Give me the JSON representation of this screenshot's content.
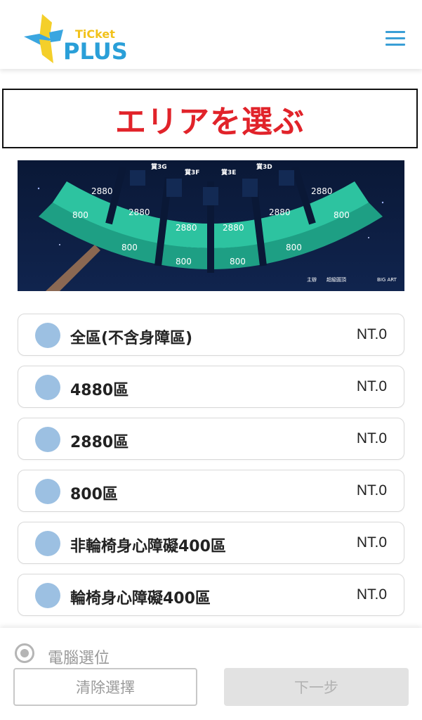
{
  "header": {
    "logo_small": "TiCket",
    "logo_big": "PLUS",
    "menu_icon": "hamburger-menu-icon"
  },
  "banner": {
    "title": "エリアを選ぶ"
  },
  "seatmap": {
    "gate_labels": [
      "賞3G",
      "賞3F",
      "賞3E",
      "賞3D"
    ],
    "inner_prices": [
      "2880",
      "2880",
      "2880",
      "2880",
      "2880",
      "2880"
    ],
    "outer_prices": [
      "800",
      "800",
      "800",
      "800",
      "800",
      "800"
    ],
    "sponsor_label": "主辦",
    "sponsor_1": "超級圓頂",
    "sponsor_2": "BIG ART",
    "colors": {
      "seat": "#2dbf9a",
      "seat_dark": "#1f9f82",
      "sky": "#0b1a3a"
    }
  },
  "zones": [
    {
      "name": "全區(不含身障區)",
      "price": "NT.0"
    },
    {
      "name": "4880區",
      "price": "NT.0"
    },
    {
      "name": "2880區",
      "price": "NT.0"
    },
    {
      "name": "800區",
      "price": "NT.0"
    },
    {
      "name": "非輪椅身心障礙400區",
      "price": "NT.0"
    },
    {
      "name": "輪椅身心障礙400區",
      "price": "NT.0"
    }
  ],
  "footer": {
    "auto_seat_label": "電腦選位",
    "clear_label": "清除選擇",
    "next_label": "下一步"
  }
}
